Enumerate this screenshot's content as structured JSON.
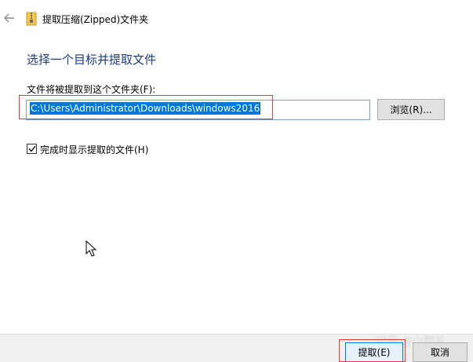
{
  "window": {
    "title": "提取压缩(Zipped)文件夹",
    "back_icon": "back-arrow-icon",
    "folder_icon": "zipped-folder-icon"
  },
  "main": {
    "heading": "选择一个目标并提取文件",
    "field_label": "文件将被提取到这个文件夹(F):",
    "path_value": "C:\\Users\\Administrator\\Downloads\\windows2016",
    "browse_label": "浏览(R)...",
    "checkbox_checked": true,
    "checkbox_label": "完成时显示提取的文件(H)"
  },
  "footer": {
    "extract_label": "提取(E)",
    "cancel_label": "取消"
  },
  "watermark": "知乎 @小肥羊",
  "colors": {
    "heading": "#1a3a8c",
    "selection": "#0078d7",
    "annotation_red": "#e03a3a",
    "footer_bg": "#f0f0f0"
  }
}
